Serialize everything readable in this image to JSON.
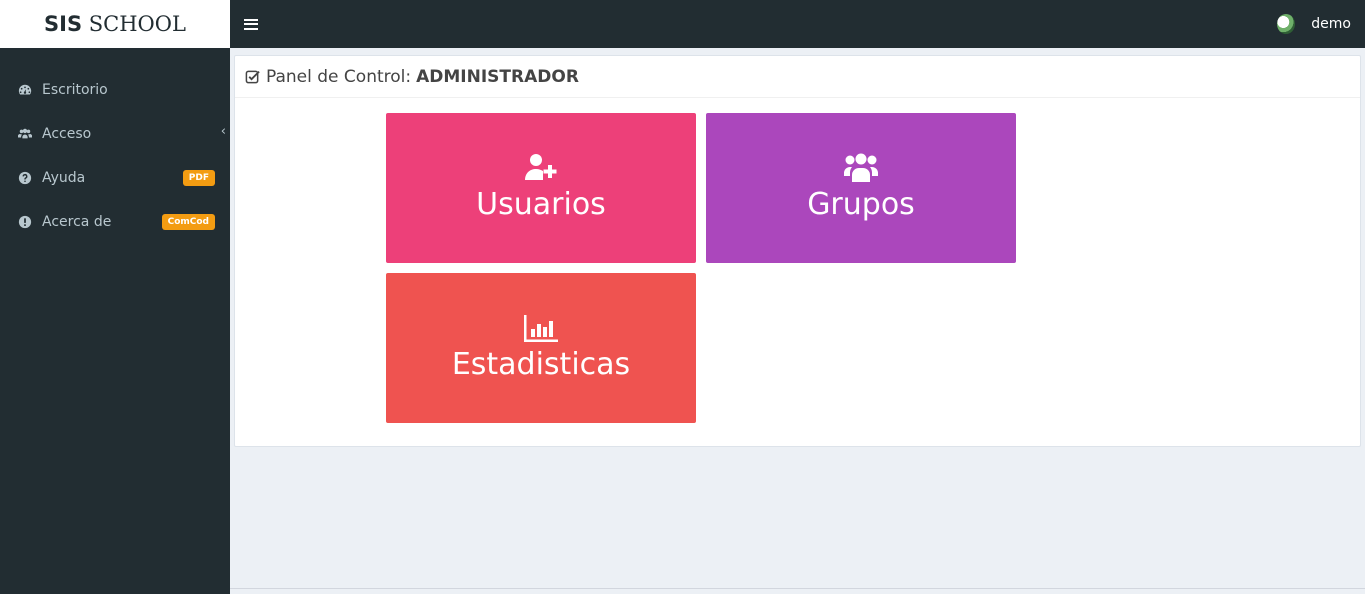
{
  "brand": {
    "bold": "SIS",
    "rest": " SCHOOL"
  },
  "topbar": {
    "username": "demo"
  },
  "sidebar": {
    "items": [
      {
        "label": "Escritorio",
        "icon": "dashboard-icon"
      },
      {
        "label": "Acceso",
        "icon": "users-icon",
        "chevron": "‹"
      },
      {
        "label": "Ayuda",
        "icon": "question-icon",
        "badge": "PDF"
      },
      {
        "label": "Acerca de",
        "icon": "exclamation-icon",
        "badge": "ComCod"
      }
    ]
  },
  "panel": {
    "title": "Panel de Control:",
    "role": "ADMINISTRADOR"
  },
  "tiles": [
    {
      "label": "Usuarios",
      "icon": "user-plus-icon",
      "color": "#ed4079"
    },
    {
      "label": "Grupos",
      "icon": "group-icon",
      "color": "#ab47bc"
    },
    {
      "label": "Estadisticas",
      "icon": "bar-chart-icon",
      "color": "#ef5350"
    }
  ],
  "colors": {
    "sidebar": "#222d32",
    "badge": "#f39c12",
    "background": "#ecf0f5"
  }
}
